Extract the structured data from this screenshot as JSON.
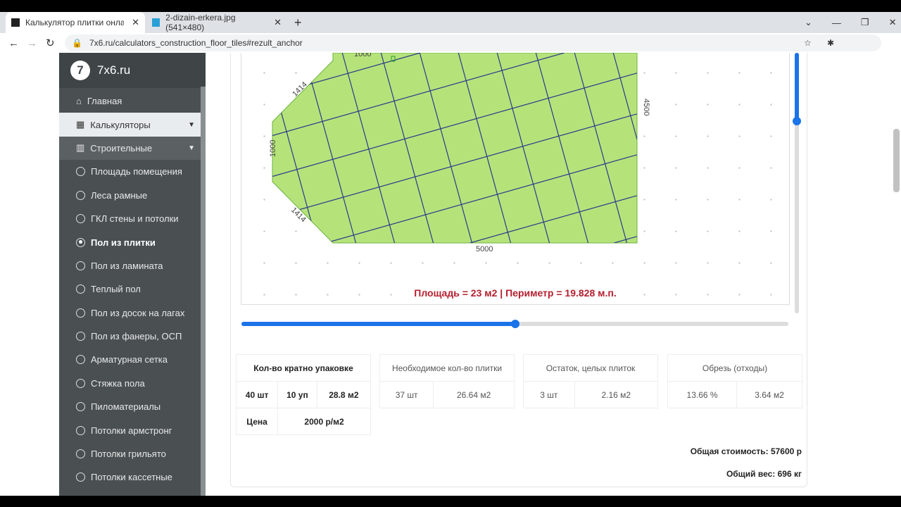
{
  "browser": {
    "tabs": [
      {
        "title": "Калькулятор плитки онлайн + с",
        "active": true
      },
      {
        "title": "2-dizain-erkera.jpg (541×480)",
        "active": false
      }
    ],
    "url": "7x6.ru/calculators_construction_floor_tiles#rezult_anchor"
  },
  "sidebar": {
    "logo": "7x6.ru",
    "items": [
      {
        "label": "Главная"
      },
      {
        "label": "Калькуляторы"
      },
      {
        "label": "Строительные"
      },
      {
        "label": "Площадь помещения"
      },
      {
        "label": "Леса рамные"
      },
      {
        "label": "ГКЛ стены и потолки"
      },
      {
        "label": "Пол из плитки",
        "selected": true
      },
      {
        "label": "Пол из ламината"
      },
      {
        "label": "Теплый пол"
      },
      {
        "label": "Пол из досок на лагах"
      },
      {
        "label": "Пол из фанеры, ОСП"
      },
      {
        "label": "Арматурная сетка"
      },
      {
        "label": "Стяжка пола"
      },
      {
        "label": "Пиломатериалы"
      },
      {
        "label": "Потолки армстронг"
      },
      {
        "label": "Потолки грильято"
      },
      {
        "label": "Потолки кассетные"
      }
    ]
  },
  "drawing": {
    "dims": {
      "top": "1000",
      "diag_top": "1414",
      "left": "1000",
      "diag_bottom": "1414",
      "bottom": "5000",
      "right": "4500"
    },
    "fill_color": "#b5e37a",
    "grid_color": "#2b3a8a",
    "result": "Площадь = 23 м2 | Периметр = 19.828 м.п."
  },
  "zoom_slider": {
    "value_percent": 50
  },
  "vertical_slider": {
    "value_percent": 25
  },
  "tables": {
    "pack": {
      "header": "Кол-во кратно упаковке",
      "pcs": "40 шт",
      "packs": "10 уп",
      "area": "28.8 м2",
      "price_label": "Цена",
      "price": "2000 р/м2"
    },
    "needed": {
      "header": "Необходимое кол-во плитки",
      "pcs": "37 шт",
      "area": "26.64 м2"
    },
    "remain": {
      "header": "Остаток, целых плиток",
      "pcs": "3 шт",
      "area": "2.16 м2"
    },
    "waste": {
      "header": "Обрезь (отходы)",
      "percent": "13.66 %",
      "area": "3.64 м2"
    }
  },
  "totals": {
    "cost": "Общая стоимость: 57600 р",
    "weight": "Общий вес: 696 кг"
  }
}
